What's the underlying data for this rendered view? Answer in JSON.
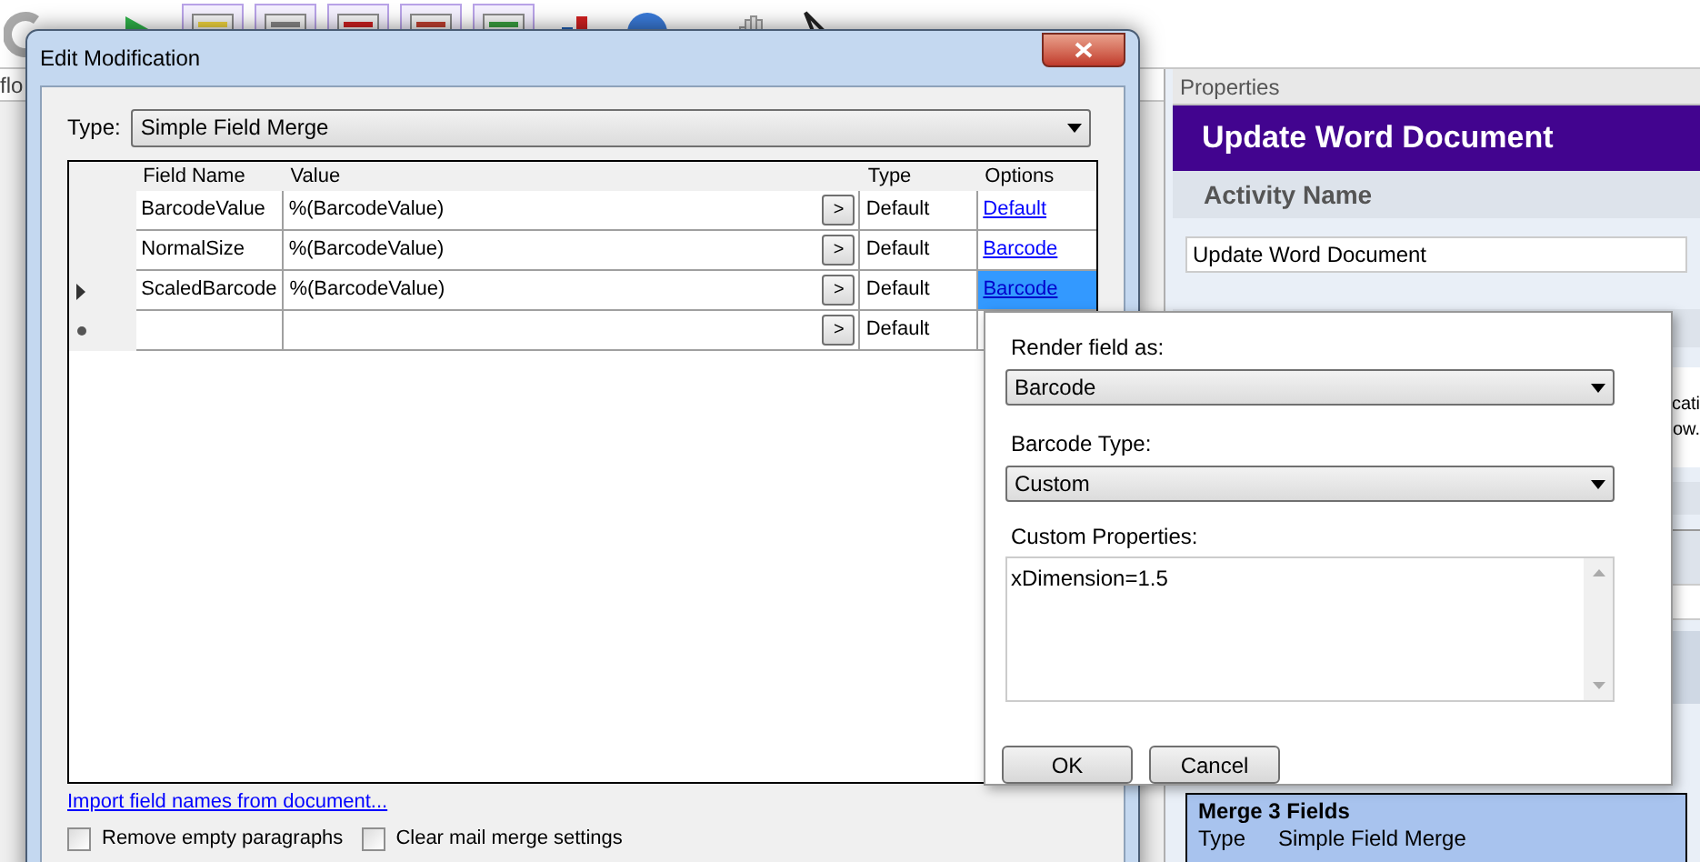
{
  "background": {
    "left_tab": "flo",
    "properties": {
      "header": "Properties",
      "title": "Update Word Document",
      "section": "Activity Name",
      "name_value": "Update Word Document",
      "cut_lines": [
        "cati",
        "ow."
      ],
      "summary": {
        "title": "Merge 3 Fields",
        "rows": [
          {
            "label": "Type",
            "value": "Simple Field Merge"
          }
        ]
      }
    }
  },
  "dialog": {
    "title": "Edit Modification",
    "type_label": "Type:",
    "type_value": "Simple Field Merge",
    "columns": [
      "Field Name",
      "Value",
      "Type",
      "Options"
    ],
    "rows": [
      {
        "kind": "data",
        "current": false,
        "field": "BarcodeValue",
        "value": "%(BarcodeValue)",
        "button": ">",
        "type": "Default",
        "option": "Default",
        "selected": false
      },
      {
        "kind": "data",
        "current": false,
        "field": "NormalSize",
        "value": "%(BarcodeValue)",
        "button": ">",
        "type": "Default",
        "option": "Barcode",
        "selected": false
      },
      {
        "kind": "data",
        "current": true,
        "field": "ScaledBarcode",
        "value": "%(BarcodeValue)",
        "button": ">",
        "type": "Default",
        "option": "Barcode",
        "selected": true
      },
      {
        "kind": "new",
        "current": false,
        "button": ">",
        "type": "Default",
        "selected": false
      }
    ],
    "link": "Import field names from document...",
    "checkboxes": [
      {
        "label": "Remove empty paragraphs",
        "checked": false
      },
      {
        "label": "Clear mail merge settings",
        "checked": false
      }
    ]
  },
  "popup": {
    "render_label": "Render field as:",
    "render_value": "Barcode",
    "barcode_type_label": "Barcode Type:",
    "barcode_type_value": "Custom",
    "custom_label": "Custom Properties:",
    "custom_value": "xDimension=1.5",
    "buttons": [
      "OK",
      "Cancel"
    ]
  }
}
